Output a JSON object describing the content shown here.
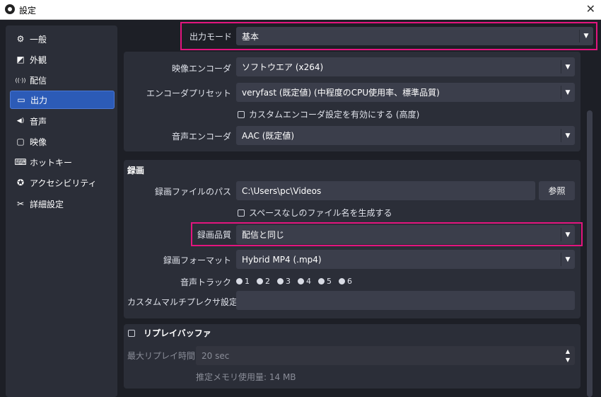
{
  "window": {
    "title": "設定",
    "close_glyph": "✕"
  },
  "sidebar": {
    "items": [
      {
        "label": "一般",
        "icon": "gear-icon",
        "glyph": "⚙"
      },
      {
        "label": "外観",
        "icon": "appearance-icon",
        "glyph": "◩"
      },
      {
        "label": "配信",
        "icon": "broadcast-icon",
        "glyph": "((·))"
      },
      {
        "label": "出力",
        "icon": "output-icon",
        "glyph": "▭"
      },
      {
        "label": "音声",
        "icon": "speaker-icon",
        "glyph": "◀)"
      },
      {
        "label": "映像",
        "icon": "monitor-icon",
        "glyph": "▢"
      },
      {
        "label": "ホットキー",
        "icon": "keyboard-icon",
        "glyph": "⌨"
      },
      {
        "label": "アクセシビリティ",
        "icon": "accessibility-icon",
        "glyph": "✪"
      },
      {
        "label": "詳細設定",
        "icon": "tools-icon",
        "glyph": "✂"
      }
    ],
    "active_index": 3
  },
  "output_mode": {
    "label": "出力モード",
    "value": "基本"
  },
  "streaming": {
    "video_encoder": {
      "label": "映像エンコーダ",
      "value": "ソフトウエア (x264)"
    },
    "encoder_preset": {
      "label": "エンコーダプリセット",
      "value": "veryfast (既定値) (中程度のCPU使用率、標準品質)"
    },
    "custom_encoder_checkbox": "カスタムエンコーダ設定を有効にする (高度)",
    "audio_encoder": {
      "label": "音声エンコーダ",
      "value": "AAC (既定値)"
    }
  },
  "recording": {
    "title": "録画",
    "path": {
      "label": "録画ファイルのパス",
      "value": "C:\\Users\\pc\\Videos",
      "browse": "参照"
    },
    "no_space_checkbox": "スペースなしのファイル名を生成する",
    "quality": {
      "label": "録画品質",
      "value": "配信と同じ"
    },
    "format": {
      "label": "録画フォーマット",
      "value": "Hybrid MP4 (.mp4)"
    },
    "audio_track": {
      "label": "音声トラック",
      "options": [
        "1",
        "2",
        "3",
        "4",
        "5",
        "6"
      ]
    },
    "muxer": {
      "label": "カスタムマルチプレクサ設定",
      "value": ""
    }
  },
  "replay_buffer": {
    "checkbox": "リプレイバッファ",
    "max_time": {
      "label": "最大リプレイ時間",
      "value": "20 sec"
    },
    "memory_usage": "推定メモリ使用量: 14 MB"
  },
  "colors": {
    "highlight": "#e3157e",
    "accent": "#2c5bb7"
  }
}
